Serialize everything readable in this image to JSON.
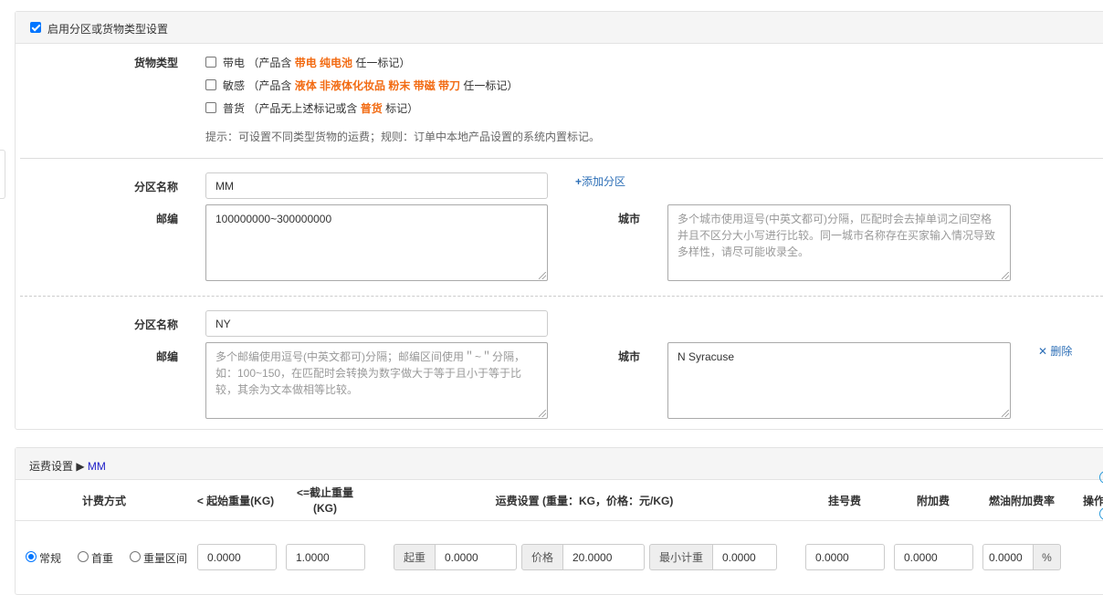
{
  "zone_panel": {
    "enable_label": "启用分区或货物类型设置",
    "cargo_type_label": "货物类型",
    "cargo_types": [
      {
        "name": "带电",
        "paren_open": "（产品含",
        "tags": "带电 纯电池",
        "suffix": "任一标记）"
      },
      {
        "name": "敏感",
        "paren_open": "（产品含",
        "tags": "液体 非液体化妆品 粉末 带磁 带刀",
        "suffix": "任一标记）"
      },
      {
        "name": "普货",
        "paren_open": "（产品无上述标记或含",
        "tags": "普货",
        "suffix": "标记）"
      }
    ],
    "hint": "提示：可设置不同类型货物的运费；规则：订单中本地产品设置的系统内置标记。",
    "zone_name_label": "分区名称",
    "postcode_label": "邮编",
    "city_label": "城市",
    "add_zone": "添加分区",
    "delete": "删除",
    "zones": [
      {
        "name": "MM",
        "postcode": "100000000~300000000",
        "postcode_placeholder": "",
        "city": "",
        "city_placeholder": "多个城市使用逗号(中英文都可)分隔，匹配时会去掉单词之间空格并且不区分大小写进行比较。同一城市名称存在买家输入情况导致多样性，请尽可能收录全。"
      },
      {
        "name": "NY",
        "postcode": "",
        "postcode_placeholder": "多个邮编使用逗号(中英文都可)分隔；邮编区间使用＂~＂分隔，如：100~150，在匹配时会转换为数字做大于等于且小于等于比较，其余为文本做相等比较。",
        "city": "N Syracuse",
        "city_placeholder": ""
      }
    ]
  },
  "freight_panel": {
    "title_prefix": "运费设置 ▶",
    "zone": "MM",
    "headers": {
      "method": "计费方式",
      "start_weight": "< 起始重量(KG)",
      "end_weight_line1": "<=截止重量",
      "end_weight_line2": "(KG)",
      "freight": "运费设置 (重量：KG，价格：元/KG)",
      "registration": "挂号费",
      "surcharge": "附加费",
      "fuel": "燃油附加费率",
      "action": "操作"
    },
    "row": {
      "methods": [
        "常规",
        "首重",
        "重量区间"
      ],
      "selected_method": "常规",
      "start_weight": "0.0000",
      "end_weight": "1.0000",
      "first_weight_label": "起重",
      "first_weight": "0.0000",
      "price_label": "价格",
      "price": "20.0000",
      "min_weight_label": "最小计重",
      "min_weight": "0.0000",
      "registration": "0.0000",
      "surcharge": "0.0000",
      "fuel": "0.0000",
      "fuel_unit": "%"
    }
  },
  "colors": {
    "accent": "#0075ff",
    "orange": "#f26b13",
    "link": "#2d6fb7"
  }
}
